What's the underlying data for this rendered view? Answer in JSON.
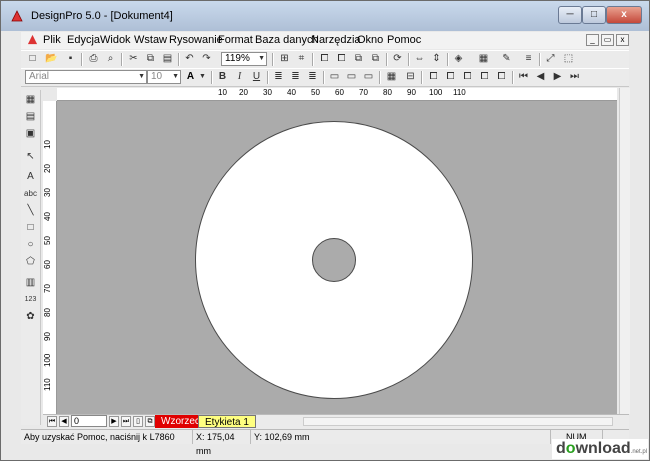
{
  "window": {
    "title": "DesignPro 5.0 - [Dokument4]",
    "buttons": {
      "minimize": "─",
      "maximize": "□",
      "close": "x"
    },
    "mdi_buttons": {
      "minimize": "_",
      "restore": "▭",
      "close": "x"
    }
  },
  "menu": [
    "Plik",
    "Edycja",
    "Widok",
    "Wstaw",
    "Rysowanie",
    "Format",
    "Baza danych",
    "Narzędzia",
    "Okno",
    "Pomoc"
  ],
  "toolbar": {
    "zoom": "119%",
    "font_name": "Arial",
    "font_size": "10",
    "bold": "B",
    "italic": "I",
    "underline": "U",
    "font_color": "A"
  },
  "ruler": {
    "h_labels": [
      "10",
      "20",
      "30",
      "40",
      "50",
      "60",
      "70",
      "80",
      "90",
      "100",
      "110"
    ],
    "v_labels": [
      "10",
      "20",
      "30",
      "40",
      "50",
      "60",
      "70",
      "80",
      "90",
      "100",
      "110"
    ]
  },
  "navigation": {
    "page_value": "0",
    "tabs": [
      "Wzorzec",
      "Etykieta 1"
    ]
  },
  "status": {
    "help": "Aby uzyskać Pomoc, naciśnij k",
    "code": "L7860",
    "x": "X: 175,04 mm",
    "y": "Y: 102,69 mm",
    "num": "NUM"
  },
  "watermark": {
    "d": "d",
    "o": "o",
    "rest": "wnload",
    "suffix": ".net.pl"
  },
  "colors": {
    "canvas": "#ababab",
    "master_tab": "#e00000",
    "label_tab": "#ffff80"
  }
}
